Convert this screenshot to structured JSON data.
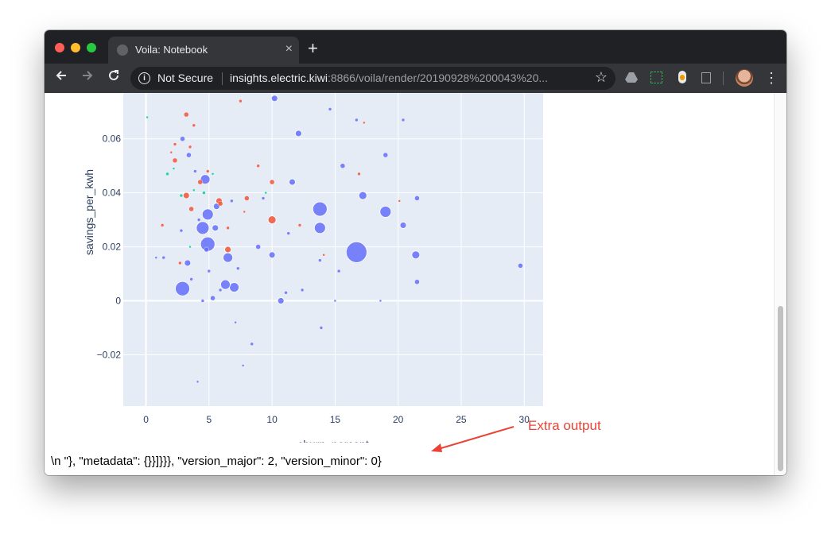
{
  "browser": {
    "tab_title": "Voila: Notebook",
    "tab_close": "×",
    "new_tab": "+",
    "security_label": "Not Secure",
    "url_host": "insights.electric.kiwi",
    "url_rest": ":8866/voila/render/20190928%200043%20...",
    "icons": [
      "back-icon",
      "forward-icon",
      "reload-icon",
      "info-icon",
      "star-icon",
      "drive-icon",
      "screenshot-icon",
      "extension-icon",
      "copy-icon",
      "avatar",
      "menu-icon"
    ]
  },
  "output_text": "\\n \"}, \"metadata\": {}}]}}}, \"version_major\": 2, \"version_minor\": 0}",
  "annotation": {
    "label": "Extra output",
    "color": "#ea4335"
  },
  "chart_data": {
    "type": "scatter",
    "title": "",
    "xlabel": "churn_percent",
    "ylabel": "savings_per_kwh",
    "xlim": [
      -1.8,
      31.5
    ],
    "ylim": [
      -0.039,
      0.077
    ],
    "xticks": [
      0,
      5,
      10,
      15,
      20,
      25,
      30
    ],
    "xtick_labels": [
      "0",
      "5",
      "10",
      "15",
      "20",
      "25",
      "30"
    ],
    "yticks": [
      -0.02,
      0,
      0.02,
      0.04,
      0.06
    ],
    "ytick_labels": [
      "−0.02",
      "0",
      "0.02",
      "0.04",
      "0.06"
    ],
    "grid": true,
    "background": "#e5ecf6",
    "colors": {
      "blue": "#636efa",
      "red": "#ef553b",
      "green": "#00cc96"
    },
    "points": [
      [
        16.7,
        0.018,
        13,
        "blue"
      ],
      [
        13.8,
        0.034,
        9,
        "blue"
      ],
      [
        13.8,
        0.027,
        7,
        "blue"
      ],
      [
        19.0,
        0.033,
        7,
        "blue"
      ],
      [
        2.9,
        0.0045,
        9,
        "blue"
      ],
      [
        4.5,
        0.027,
        8,
        "blue"
      ],
      [
        4.9,
        0.021,
        9,
        "blue"
      ],
      [
        4.9,
        0.032,
        7,
        "blue"
      ],
      [
        7.0,
        0.005,
        6,
        "blue"
      ],
      [
        6.3,
        0.006,
        6,
        "blue"
      ],
      [
        6.5,
        0.016,
        6,
        "blue"
      ],
      [
        17.2,
        0.039,
        5,
        "blue"
      ],
      [
        21.4,
        0.017,
        5,
        "blue"
      ],
      [
        4.7,
        0.045,
        6,
        "blue"
      ],
      [
        10.2,
        0.075,
        4,
        "blue"
      ],
      [
        12.1,
        0.062,
        4,
        "blue"
      ],
      [
        11.6,
        0.044,
        4,
        "blue"
      ],
      [
        10.0,
        0.017,
        4,
        "blue"
      ],
      [
        20.4,
        0.028,
        4,
        "blue"
      ],
      [
        10.7,
        0.0,
        4,
        "blue"
      ],
      [
        19.0,
        0.054,
        3,
        "blue"
      ],
      [
        21.5,
        0.007,
        3,
        "blue"
      ],
      [
        29.7,
        0.013,
        3,
        "blue"
      ],
      [
        15.6,
        0.05,
        3,
        "blue"
      ],
      [
        3.4,
        0.054,
        3,
        "blue"
      ],
      [
        5.5,
        0.027,
        4,
        "blue"
      ],
      [
        5.3,
        0.001,
        3,
        "blue"
      ],
      [
        8.9,
        0.02,
        3,
        "blue"
      ],
      [
        2.9,
        0.06,
        3,
        "blue"
      ],
      [
        21.5,
        0.038,
        3,
        "blue"
      ],
      [
        5.6,
        0.035,
        4,
        "blue"
      ],
      [
        3.3,
        0.014,
        4,
        "blue"
      ],
      [
        4.8,
        0.019,
        3,
        "blue"
      ],
      [
        16.7,
        0.067,
        2,
        "blue"
      ],
      [
        14.6,
        0.071,
        2,
        "blue"
      ],
      [
        20.4,
        0.067,
        2,
        "blue"
      ],
      [
        13.8,
        0.015,
        2,
        "blue"
      ],
      [
        12.4,
        0.004,
        2,
        "blue"
      ],
      [
        13.9,
        -0.01,
        2,
        "blue"
      ],
      [
        8.4,
        -0.016,
        2,
        "blue"
      ],
      [
        5.9,
        0.004,
        2,
        "blue"
      ],
      [
        2.8,
        0.026,
        2,
        "blue"
      ],
      [
        4.2,
        0.03,
        2,
        "blue"
      ],
      [
        1.4,
        0.016,
        2,
        "blue"
      ],
      [
        9.3,
        0.038,
        2,
        "blue"
      ],
      [
        7.3,
        0.012,
        2,
        "blue"
      ],
      [
        5.0,
        0.011,
        2,
        "blue"
      ],
      [
        3.6,
        0.008,
        2,
        "blue"
      ],
      [
        4.5,
        0.0,
        2,
        "blue"
      ],
      [
        6.8,
        0.037,
        2,
        "blue"
      ],
      [
        11.3,
        0.025,
        2,
        "blue"
      ],
      [
        15.3,
        0.011,
        2,
        "blue"
      ],
      [
        7.7,
        -0.024,
        1.5,
        "blue"
      ],
      [
        4.1,
        -0.03,
        1.5,
        "blue"
      ],
      [
        18.6,
        0.0,
        1.5,
        "blue"
      ],
      [
        0.8,
        0.016,
        1.5,
        "blue"
      ],
      [
        3.9,
        0.048,
        2,
        "blue"
      ],
      [
        7.1,
        -0.008,
        1.5,
        "blue"
      ],
      [
        11.1,
        0.003,
        2,
        "blue"
      ],
      [
        15.0,
        0.0,
        1.5,
        "blue"
      ],
      [
        10.0,
        0.03,
        5,
        "red"
      ],
      [
        5.8,
        0.037,
        4,
        "red"
      ],
      [
        2.3,
        0.052,
        3,
        "red"
      ],
      [
        3.2,
        0.039,
        4,
        "red"
      ],
      [
        6.5,
        0.019,
        4,
        "red"
      ],
      [
        10.0,
        0.044,
        3,
        "red"
      ],
      [
        8.0,
        0.038,
        3,
        "red"
      ],
      [
        3.2,
        0.069,
        3,
        "red"
      ],
      [
        3.6,
        0.034,
        3,
        "red"
      ],
      [
        2.3,
        0.058,
        2,
        "red"
      ],
      [
        1.3,
        0.028,
        2,
        "red"
      ],
      [
        4.3,
        0.044,
        3,
        "red"
      ],
      [
        5.9,
        0.036,
        3,
        "red"
      ],
      [
        8.9,
        0.05,
        2,
        "red"
      ],
      [
        6.5,
        0.027,
        2,
        "red"
      ],
      [
        3.5,
        0.057,
        2,
        "red"
      ],
      [
        12.2,
        0.028,
        2,
        "red"
      ],
      [
        2.7,
        0.014,
        2,
        "red"
      ],
      [
        7.5,
        0.074,
        2,
        "red"
      ],
      [
        16.9,
        0.047,
        2,
        "red"
      ],
      [
        17.3,
        0.066,
        1.5,
        "red"
      ],
      [
        20.1,
        0.037,
        1.5,
        "red"
      ],
      [
        3.8,
        0.065,
        2,
        "red"
      ],
      [
        4.9,
        0.048,
        2,
        "red"
      ],
      [
        2.0,
        0.055,
        1.5,
        "red"
      ],
      [
        7.8,
        0.033,
        1.5,
        "red"
      ],
      [
        14.1,
        0.017,
        1.5,
        "red"
      ],
      [
        1.7,
        0.047,
        2,
        "green"
      ],
      [
        4.6,
        0.04,
        2,
        "green"
      ],
      [
        2.8,
        0.039,
        2,
        "green"
      ],
      [
        3.8,
        0.041,
        1.5,
        "green"
      ],
      [
        2.2,
        0.049,
        1.5,
        "green"
      ],
      [
        0.1,
        0.068,
        1.5,
        "green"
      ],
      [
        3.5,
        0.02,
        1.5,
        "green"
      ],
      [
        5.3,
        0.047,
        1.5,
        "green"
      ],
      [
        9.5,
        0.04,
        1.5,
        "green"
      ]
    ]
  }
}
